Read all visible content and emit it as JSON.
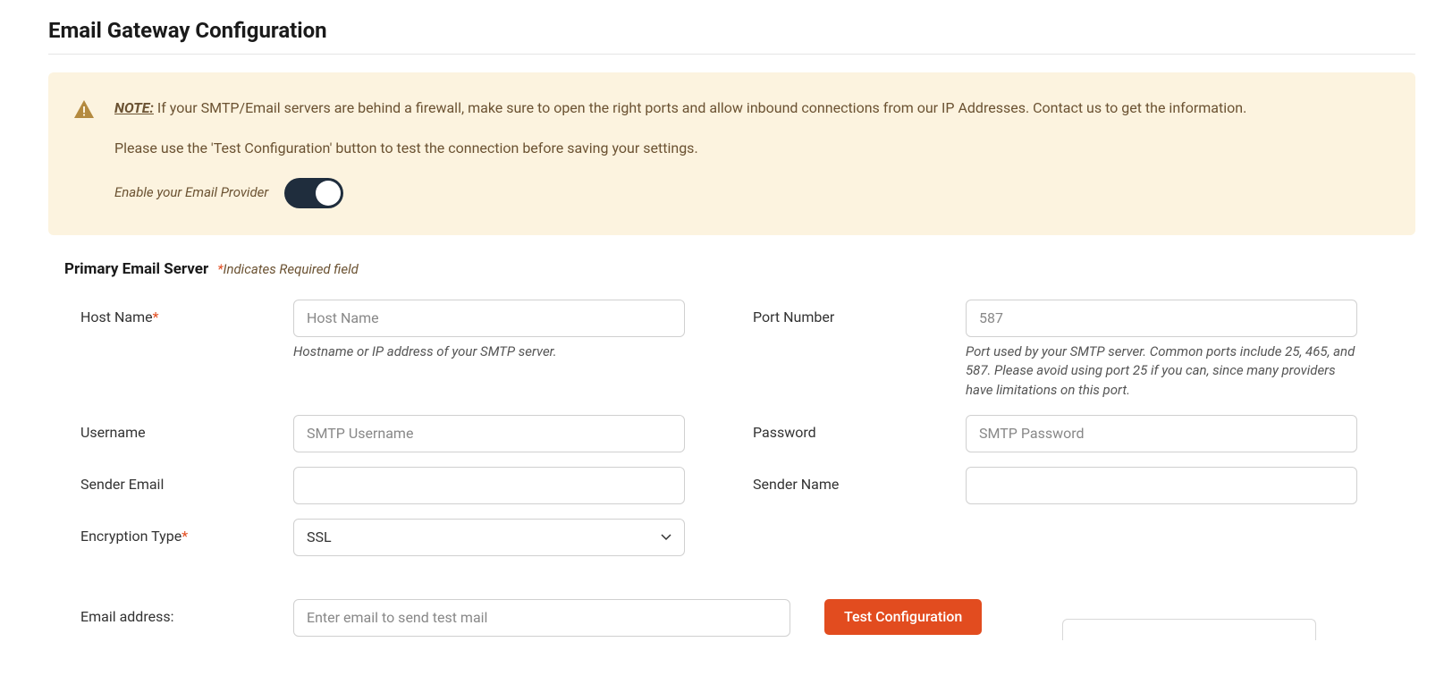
{
  "page_title": "Email Gateway Configuration",
  "note": {
    "label": "NOTE:",
    "line1": " If your SMTP/Email servers are behind a firewall, make sure to open the right ports and allow inbound connections from our IP Addresses. Contact us to get the information.",
    "line2": "Please use the 'Test Configuration' button to test the connection before saving your settings.",
    "toggle_label": "Enable your Email Provider"
  },
  "section": {
    "title": "Primary Email Server",
    "req_note_star": "*",
    "req_note_text": "Indicates Required field"
  },
  "fields": {
    "host": {
      "label": "Host Name",
      "placeholder": "Host Name",
      "help": "Hostname or IP address of your SMTP server."
    },
    "port": {
      "label": "Port Number",
      "placeholder": "587",
      "help": "Port used by your SMTP server. Common ports include 25, 465, and 587. Please avoid using port 25 if you can, since many providers have limitations on this port."
    },
    "user": {
      "label": "Username",
      "placeholder": "SMTP Username"
    },
    "pass": {
      "label": "Password",
      "placeholder": "SMTP Password"
    },
    "sender_email": {
      "label": "Sender Email"
    },
    "sender_name": {
      "label": "Sender Name"
    },
    "encryption": {
      "label": "Encryption Type",
      "value": "SSL"
    },
    "test_email": {
      "label": "Email address:",
      "placeholder": "Enter email to send test mail"
    }
  },
  "buttons": {
    "test": "Test Configuration"
  }
}
